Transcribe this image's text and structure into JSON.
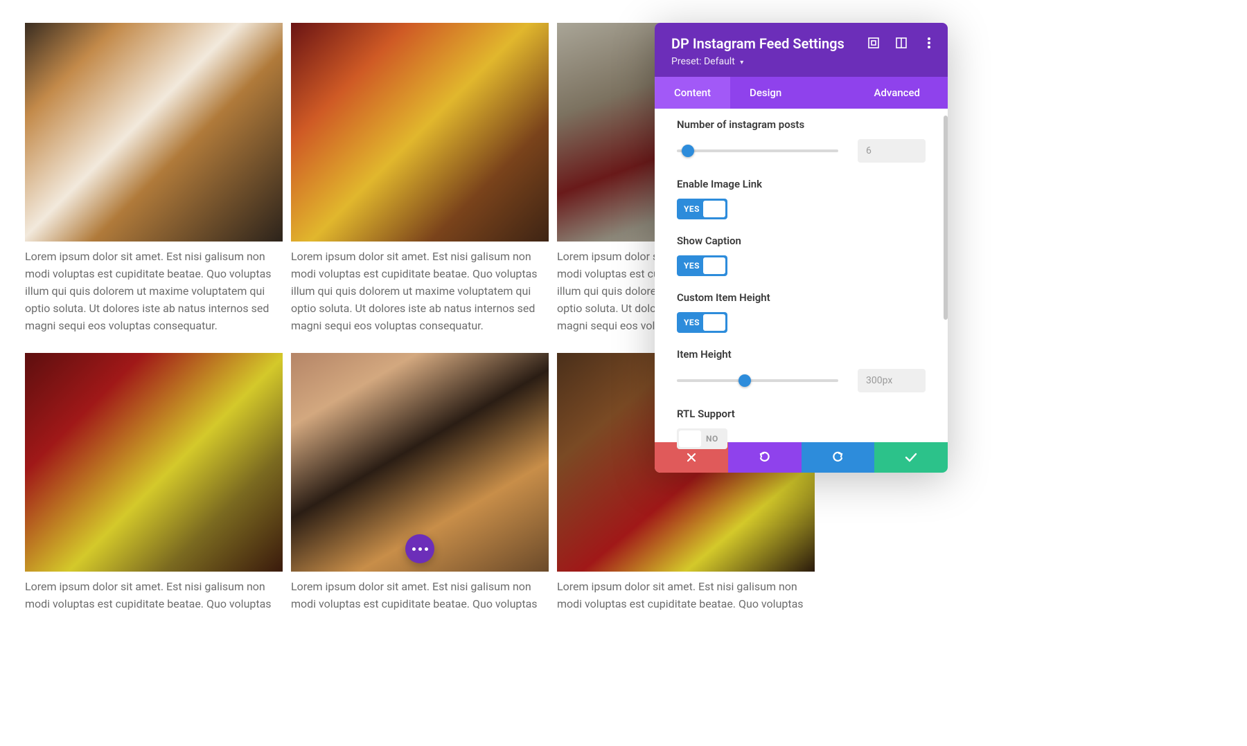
{
  "feed": {
    "caption": "Lorem ipsum dolor sit amet. Est nisi galisum non modi voluptas est cupiditate beatae. Quo voluptas illum qui quis dolorem ut maxime voluptatem qui optio soluta. Ut dolores iste ab natus internos sed magni sequi eos voluptas consequatur.",
    "caption_short": "Lorem ipsum dolor sit amet. Est nisi galisum non modi voluptas est cupiditate beatae. Quo voluptas"
  },
  "fab": {
    "name": "more-actions"
  },
  "panel": {
    "title": "DP Instagram Feed Settings",
    "preset_label": "Preset:",
    "preset_value": "Default",
    "tabs": {
      "content": "Content",
      "design": "Design",
      "advanced": "Advanced",
      "active": "content"
    },
    "fields": {
      "num_posts": {
        "label": "Number of instagram posts",
        "value": "6",
        "slider_pct": 3
      },
      "enable_link": {
        "label": "Enable Image Link",
        "on": true,
        "on_text": "YES"
      },
      "show_caption": {
        "label": "Show Caption",
        "on": true,
        "on_text": "YES"
      },
      "custom_height": {
        "label": "Custom Item Height",
        "on": true,
        "on_text": "YES"
      },
      "item_height": {
        "label": "Item Height",
        "value": "300px",
        "slider_pct": 38
      },
      "rtl": {
        "label": "RTL Support",
        "on": false,
        "off_text": "NO"
      }
    },
    "footer": {
      "cancel": "cancel",
      "undo": "undo",
      "redo": "redo",
      "ok": "save"
    }
  }
}
